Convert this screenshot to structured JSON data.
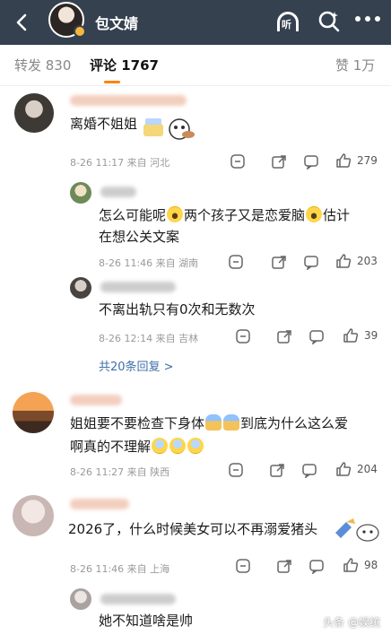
{
  "header": {
    "name": "包文婧",
    "listen_label": "听"
  },
  "tabs": {
    "repost_label": "转发 830",
    "comment_label": "评论 1767",
    "like_label": "赞 1万"
  },
  "comments": [
    {
      "text": "离婚不姐姐",
      "meta": "8-26 11:17 来自 河北",
      "likes": "279"
    },
    {
      "text1": "怎么可能呢",
      "text2": "两个孩子又是恋爱脑",
      "text3": "估计",
      "text4": "在想公关文案",
      "meta": "8-26 11:46 来自 湖南",
      "likes": "203"
    },
    {
      "text": "不离出轨只有0次和无数次",
      "meta": "8-26 12:14 来自 吉林",
      "likes": "39"
    },
    {
      "more": "共20条回复 >"
    },
    {
      "text1": "姐姐要不要检查下身体",
      "text2": "到底为什么这么爱",
      "text3": "啊真的不理解",
      "meta": "8-26 11:27 来自 陕西",
      "likes": "204"
    },
    {
      "text": "2026了，什么时候美女可以不再溺爱猪头",
      "meta": "8-26 11:46 来自 上海",
      "likes": "98"
    },
    {
      "text": "她不知道啥是帅"
    }
  ],
  "watermark": "头条 @娱统",
  "colors": {
    "topbar": "#35414f",
    "accent": "#ff8200",
    "link": "#3f6fa8"
  }
}
